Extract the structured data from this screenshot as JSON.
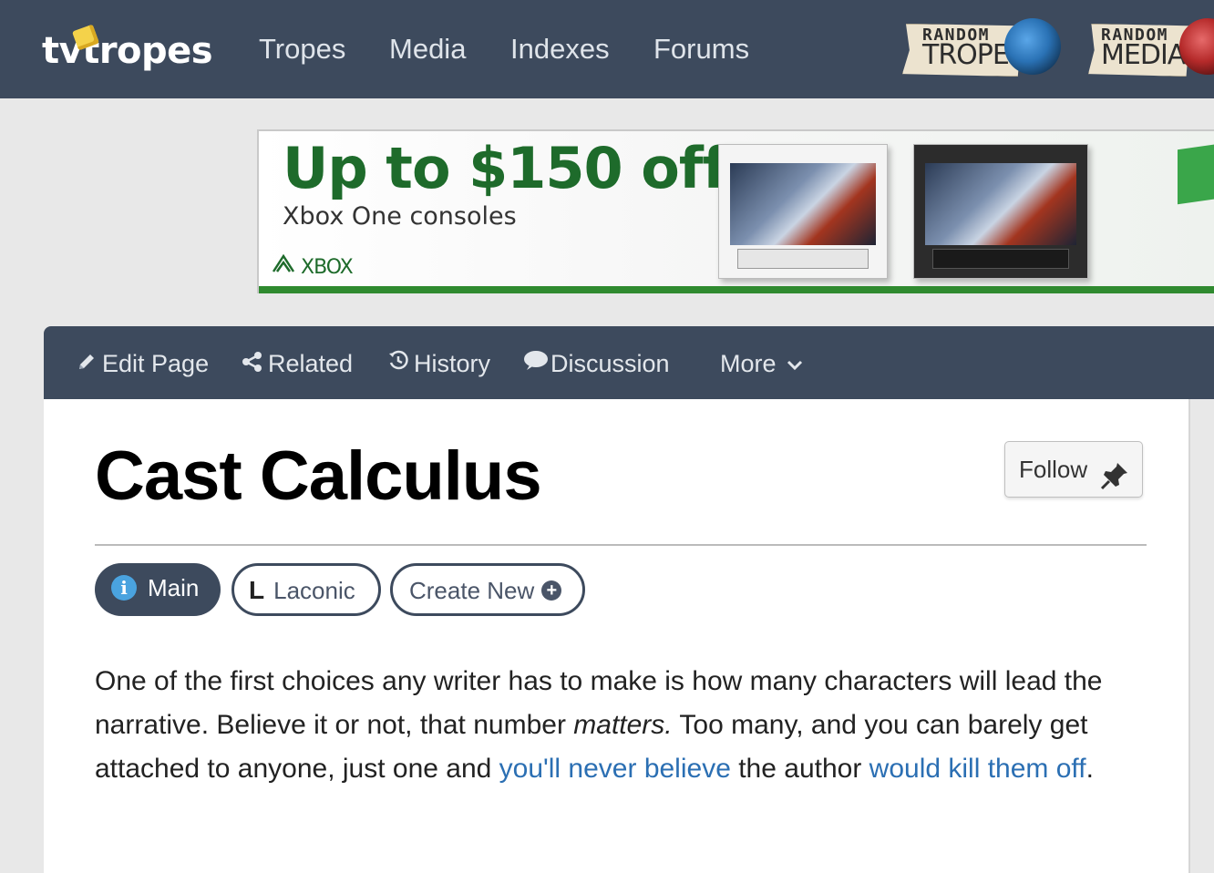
{
  "site": {
    "logo_text": "tvtropes",
    "nav": [
      "Tropes",
      "Media",
      "Indexes",
      "Forums"
    ],
    "random_trope": {
      "top": "RANDOM",
      "bottom": "TROPE"
    },
    "random_media": {
      "top": "RANDOM",
      "bottom": "MEDIA"
    }
  },
  "ad": {
    "headline": "Up to $150 off",
    "subline": "Xbox One consoles",
    "brand": "XBOX",
    "accent_color": "#1e6b2b"
  },
  "toolbar": {
    "edit": "Edit Page",
    "related": "Related",
    "history": "History",
    "discussion": "Discussion",
    "more": "More"
  },
  "page": {
    "title": "Cast Calculus",
    "follow": "Follow",
    "tabs": {
      "main": "Main",
      "laconic": "Laconic",
      "create": "Create New"
    },
    "paragraph": {
      "part1": "One of the first choices any writer has to make is how many characters will lead the narrative. Believe it or not, that number ",
      "emphasis": "matters.",
      "part2": " Too many, and you can barely get attached to anyone, just one and ",
      "link1": "you'll never believe",
      "part3": " the author ",
      "link2": "would kill them off",
      "part4": "."
    }
  },
  "colors": {
    "nav_bg": "#3d4a5d",
    "link": "#2b6fb3",
    "info_dot": "#4aa3df"
  },
  "icons": [
    "pencil-icon",
    "share-icon",
    "history-icon",
    "speech-bubble-icon",
    "chevron-down-icon",
    "pushpin-icon",
    "info-icon",
    "laconic-icon",
    "plus-circle-icon"
  ]
}
